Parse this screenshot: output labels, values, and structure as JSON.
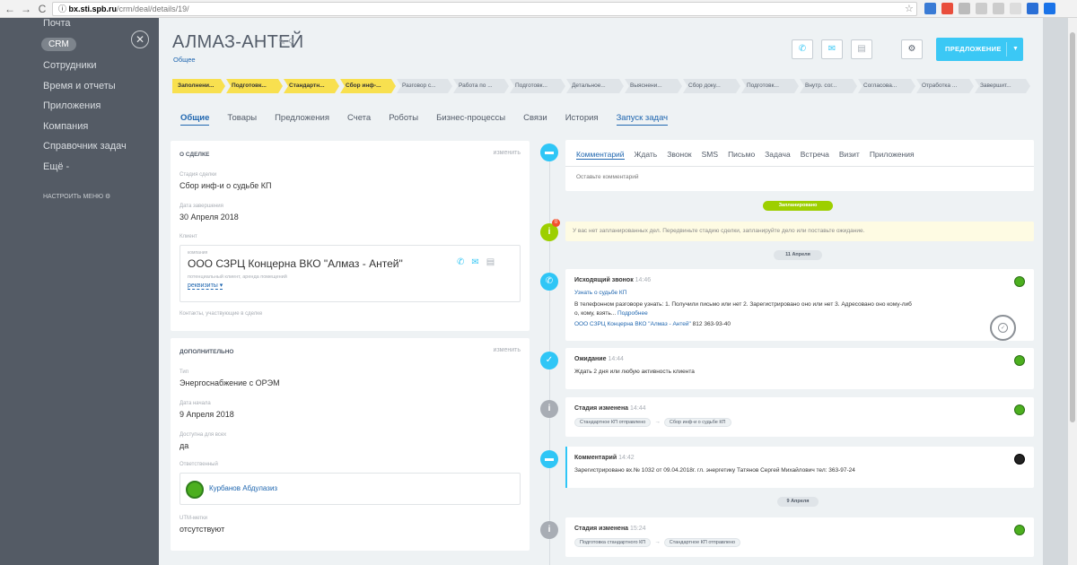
{
  "browser": {
    "url_domain": "bx.sti.spb.ru",
    "url_path": "/crm/deal/details/19/",
    "icons": [
      "back-icon",
      "forward-icon",
      "reload-icon",
      "info-icon",
      "star-icon"
    ]
  },
  "sidebar": {
    "items": [
      {
        "label": "Почта"
      },
      {
        "label": "CRM"
      },
      {
        "label": "Сотрудники"
      },
      {
        "label": "Время и отчеты"
      },
      {
        "label": "Приложения"
      },
      {
        "label": "Компания"
      },
      {
        "label": "Справочник задач"
      },
      {
        "label": "Ещё -"
      }
    ],
    "config_label": "НАСТРОИТЬ МЕНЮ ⚙"
  },
  "header": {
    "title": "АЛМАЗ-АНТЕЙ",
    "subtitle": "Общее",
    "offer_button": "ПРЕДЛОЖЕНИЕ",
    "accent": "#3bc8f5"
  },
  "stages": [
    {
      "label": "Заполнени...",
      "done": true
    },
    {
      "label": "Подготовк...",
      "done": true
    },
    {
      "label": "Стандартн...",
      "done": true
    },
    {
      "label": "Сбор инф-...",
      "done": true
    },
    {
      "label": "Разговор с...",
      "done": false
    },
    {
      "label": "Работа по ...",
      "done": false
    },
    {
      "label": "Подготовк...",
      "done": false
    },
    {
      "label": "Детальное...",
      "done": false
    },
    {
      "label": "Выяснени...",
      "done": false
    },
    {
      "label": "Сбор доку...",
      "done": false
    },
    {
      "label": "Подготовк...",
      "done": false
    },
    {
      "label": "Внутр. сог...",
      "done": false
    },
    {
      "label": "Согласова...",
      "done": false
    },
    {
      "label": "Отработка ...",
      "done": false
    },
    {
      "label": "Завершит...",
      "done": false
    }
  ],
  "tabs": [
    {
      "label": "Общие"
    },
    {
      "label": "Товары"
    },
    {
      "label": "Предложения"
    },
    {
      "label": "Счета"
    },
    {
      "label": "Роботы"
    },
    {
      "label": "Бизнес-процессы"
    },
    {
      "label": "Связи"
    },
    {
      "label": "История"
    },
    {
      "label": "Запуск задач"
    }
  ],
  "about": {
    "heading": "О СДЕЛКЕ",
    "edit": "изменить",
    "stage_label": "Стадия сделки",
    "stage_value": "Сбор инф-и о судьбе КП",
    "close_label": "Дата завершения",
    "close_value": "30 Апреля 2018",
    "client_label": "Клиент",
    "company_label": "компания",
    "company_name": "ООО СЗРЦ Концерна ВКО \"Алмаз - Антей\"",
    "company_desc": "потенциальный клиент, аренда помещений",
    "requisites": "реквизиты ▾",
    "contacts_label": "Контакты, участвующие в сделке"
  },
  "extra": {
    "heading": "ДОПОЛНИТЕЛЬНО",
    "edit": "изменить",
    "type_label": "Тип",
    "type_value": "Энергоснабжение с ОРЭМ",
    "start_label": "Дата начала",
    "start_value": "9 Апреля 2018",
    "access_label": "Доступна для всех",
    "access_value": "да",
    "resp_label": "Ответственный",
    "resp_name": "Курбанов Абдулазиз",
    "utm_label": "UTM-метки",
    "utm_value": "отсутствуют"
  },
  "composer": {
    "tabs": [
      "Комментарий",
      "Ждать",
      "Звонок",
      "SMS",
      "Письмо",
      "Задача",
      "Встреча",
      "Визит",
      "Приложения"
    ],
    "placeholder": "Оставьте комментарий"
  },
  "timeline": {
    "planned_pill": "Запланировано",
    "notice_badge": "0",
    "notice": "У вас нет запланированных дел. Передвиньте стадию сделки, запланируйте дело или поставьте ожидание.",
    "date1": "11 Апреля",
    "call_title": "Исходящий звонок",
    "call_time": "14:46",
    "call_subject": "Узнать о судьбе КП",
    "call_text1": "В телефонном разговоре узнать: 1. Получили письмо или нет 2. Зарегистрировано оно или нет 3. Адресовано оно кому-либ",
    "call_text2": "о, кому, взять...",
    "call_more": "Подробнее",
    "call_company": "ООО СЗРЦ Концерна ВКО \"Алмаз - Антей\"",
    "call_phone": "812 363-93-40",
    "wait_title": "Ожидание",
    "wait_time": "14:44",
    "wait_text": "Ждать 2 дня или любую активность клиента",
    "stage1_title": "Стадия изменена",
    "stage1_time": "14:44",
    "stage1_from": "Стандартное КП отправлено",
    "stage1_to": "Сбор инф-и о судьбе КП",
    "comment_title": "Комментарий",
    "comment_time": "14:42",
    "comment_text": "Зарегистрировано вх.№ 1032 от 09.04.2018г. гл. энергетику Татянов Сергей Михайлович тел: 363-97-24",
    "date2": "9 Апреля",
    "stage2_title": "Стадия изменена",
    "stage2_time": "15:24",
    "stage2_from": "Подготовка стандартного КП",
    "stage2_to": "Стандартное КП отправлено"
  }
}
